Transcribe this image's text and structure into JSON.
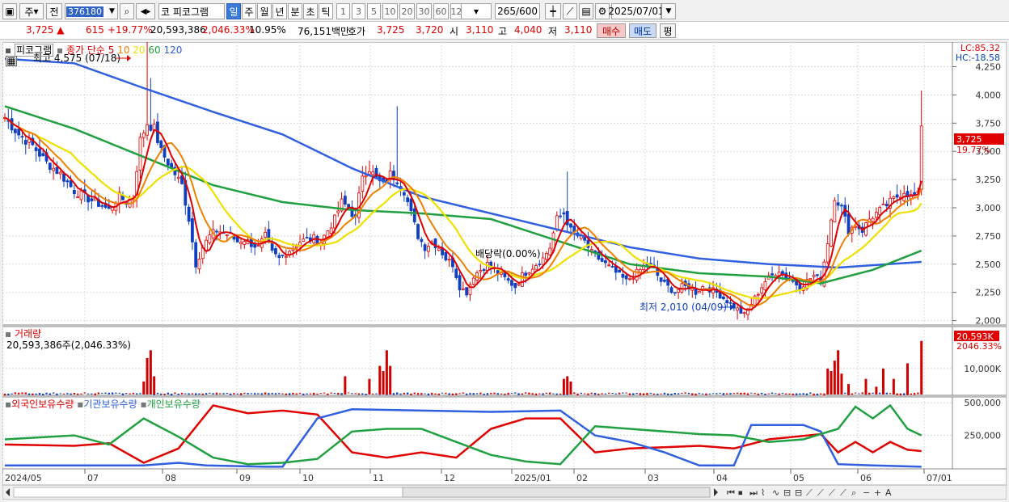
{
  "toolbar": {
    "market": "주",
    "prev_label": "전",
    "code": "376180",
    "stock_name_prefix": "코",
    "stock_name": "피코그램",
    "periods": [
      "일",
      "주",
      "월",
      "년",
      "분",
      "초",
      "틱"
    ],
    "active_period": "일",
    "intervals": [
      "1",
      "3",
      "5",
      "10",
      "20",
      "30",
      "60",
      "120"
    ],
    "count": "265",
    "count_total": "/600",
    "date": "2025/07/01"
  },
  "quote": {
    "price": "3,725",
    "direction": "▲",
    "change": "615",
    "change_pct": "+19.77%",
    "volume": "20,593,386",
    "volume_pct": "2,046.33%",
    "turnover_pct": "10.95%",
    "amount": "76,151백만",
    "ask_label": "호가",
    "ask": "3,725",
    "bid": "3,720",
    "open_label": "시",
    "open": "3,110",
    "high_label": "고",
    "high": "4,040",
    "low_label": "저",
    "low": "3,110",
    "buy_label": "매수",
    "sell_label": "매도",
    "eval_label": "평"
  },
  "price_panel": {
    "title": "피코그램",
    "ma_label": "종가 단순",
    "ma_periods": [
      "5",
      "10",
      "20",
      "60",
      "120"
    ],
    "ma_colors": [
      "#e00000",
      "#f08000",
      "#f0e000",
      "#20a040",
      "#3060e0"
    ],
    "high_annot": "최고 4,575 (07/18)",
    "low_annot": "최저 2,010 (04/09)",
    "dividend_annot": "배당락(0.00%)",
    "lc": "LC:85.32",
    "hc": "HC:-18.58",
    "last_price": "3,725",
    "last_pct": "19.77%"
  },
  "volume_panel": {
    "title": "거래량",
    "value_text": "20,593,386주(2,046.33%)",
    "last_label": "20,593K",
    "last_pct": "2046.33%"
  },
  "holdings_panel": {
    "series": [
      "외국인보유수량",
      "기관보유수량",
      "개인보유수량"
    ],
    "colors": [
      "#e00000",
      "#3060e0",
      "#20a040"
    ]
  },
  "chart_data": [
    {
      "type": "candlestick",
      "title": "피코그램",
      "x_ticks": [
        "2024/05",
        "07",
        "08",
        "09",
        "10",
        "11",
        "12",
        "2025/01",
        "02",
        "03",
        "04",
        "05",
        "06",
        "07/01"
      ],
      "y_ticks": [
        2000,
        2250,
        2500,
        2750,
        3000,
        3250,
        3500,
        3750,
        4000,
        4250
      ],
      "ylim": [
        1990,
        4440
      ],
      "close_series": [
        [
          0,
          3800
        ],
        [
          4,
          3650
        ],
        [
          8,
          3550
        ],
        [
          12,
          3400
        ],
        [
          16,
          3300
        ],
        [
          20,
          3150
        ],
        [
          24,
          3080
        ],
        [
          28,
          3020
        ],
        [
          30,
          2980
        ],
        [
          33,
          3100
        ],
        [
          35,
          3050
        ],
        [
          37,
          3100
        ],
        [
          39,
          3600
        ],
        [
          41,
          3750
        ],
        [
          43,
          3700
        ],
        [
          45,
          3500
        ],
        [
          47,
          3400
        ],
        [
          49,
          3300
        ],
        [
          51,
          3200
        ],
        [
          53,
          2900
        ],
        [
          55,
          2500
        ],
        [
          57,
          2650
        ],
        [
          59,
          2750
        ],
        [
          61,
          2800
        ],
        [
          63,
          2780
        ],
        [
          65,
          2750
        ],
        [
          67,
          2700
        ],
        [
          69,
          2720
        ],
        [
          71,
          2680
        ],
        [
          73,
          2650
        ],
        [
          75,
          2750
        ],
        [
          77,
          2600
        ],
        [
          79,
          2550
        ],
        [
          81,
          2600
        ],
        [
          83,
          2650
        ],
        [
          85,
          2700
        ],
        [
          87,
          2720
        ],
        [
          89,
          2730
        ],
        [
          91,
          2700
        ],
        [
          93,
          2800
        ],
        [
          95,
          2900
        ],
        [
          97,
          3050
        ],
        [
          99,
          3000
        ],
        [
          101,
          2900
        ],
        [
          103,
          3300
        ],
        [
          105,
          3350
        ],
        [
          107,
          3250
        ],
        [
          109,
          3200
        ],
        [
          111,
          3300
        ],
        [
          113,
          3250
        ],
        [
          115,
          3150
        ],
        [
          117,
          2950
        ],
        [
          119,
          2750
        ],
        [
          121,
          2650
        ],
        [
          123,
          2700
        ],
        [
          125,
          2650
        ],
        [
          127,
          2550
        ],
        [
          129,
          2500
        ],
        [
          131,
          2300
        ],
        [
          133,
          2250
        ],
        [
          135,
          2400
        ],
        [
          137,
          2450
        ],
        [
          139,
          2500
        ],
        [
          141,
          2450
        ],
        [
          143,
          2400
        ],
        [
          145,
          2350
        ],
        [
          147,
          2300
        ],
        [
          149,
          2400
        ],
        [
          151,
          2450
        ],
        [
          153,
          2500
        ],
        [
          155,
          2550
        ],
        [
          157,
          2650
        ],
        [
          159,
          2900
        ],
        [
          161,
          2950
        ],
        [
          163,
          2800
        ],
        [
          165,
          2750
        ],
        [
          167,
          2700
        ],
        [
          169,
          2600
        ],
        [
          171,
          2550
        ],
        [
          173,
          2500
        ],
        [
          175,
          2450
        ],
        [
          177,
          2400
        ],
        [
          179,
          2350
        ],
        [
          181,
          2400
        ],
        [
          183,
          2450
        ],
        [
          185,
          2500
        ],
        [
          187,
          2450
        ],
        [
          189,
          2350
        ],
        [
          191,
          2300
        ],
        [
          193,
          2250
        ],
        [
          195,
          2300
        ],
        [
          197,
          2300
        ],
        [
          199,
          2250
        ],
        [
          201,
          2300
        ],
        [
          203,
          2280
        ],
        [
          205,
          2250
        ],
        [
          207,
          2200
        ],
        [
          209,
          2150
        ],
        [
          211,
          2100
        ],
        [
          213,
          2050
        ],
        [
          215,
          2150
        ],
        [
          217,
          2250
        ],
        [
          219,
          2350
        ],
        [
          221,
          2400
        ],
        [
          223,
          2450
        ],
        [
          225,
          2380
        ],
        [
          227,
          2350
        ],
        [
          229,
          2300
        ],
        [
          231,
          2350
        ],
        [
          233,
          2400
        ],
        [
          235,
          2350
        ],
        [
          237,
          2700
        ],
        [
          239,
          3100
        ],
        [
          241,
          3000
        ],
        [
          243,
          2800
        ],
        [
          245,
          2850
        ],
        [
          247,
          2800
        ],
        [
          249,
          2900
        ],
        [
          251,
          2950
        ],
        [
          253,
          3000
        ],
        [
          255,
          3050
        ],
        [
          257,
          3100
        ],
        [
          259,
          3150
        ],
        [
          261,
          3100
        ],
        [
          263,
          3110
        ],
        [
          264,
          3725
        ]
      ],
      "ma120": [
        [
          0,
          4320
        ],
        [
          20,
          4280
        ],
        [
          40,
          4060
        ],
        [
          60,
          3850
        ],
        [
          80,
          3650
        ],
        [
          100,
          3350
        ],
        [
          120,
          3100
        ],
        [
          140,
          2950
        ],
        [
          160,
          2800
        ],
        [
          180,
          2650
        ],
        [
          200,
          2550
        ],
        [
          220,
          2500
        ],
        [
          240,
          2470
        ],
        [
          264,
          2520
        ]
      ],
      "ma60": [
        [
          0,
          3900
        ],
        [
          20,
          3700
        ],
        [
          40,
          3450
        ],
        [
          60,
          3200
        ],
        [
          80,
          3050
        ],
        [
          100,
          2980
        ],
        [
          120,
          2950
        ],
        [
          140,
          2900
        ],
        [
          160,
          2700
        ],
        [
          180,
          2500
        ],
        [
          200,
          2420
        ],
        [
          220,
          2390
        ],
        [
          235,
          2330
        ],
        [
          250,
          2450
        ],
        [
          264,
          2620
        ]
      ]
    },
    {
      "type": "bar",
      "title": "거래량",
      "y_ticks": [
        10000
      ],
      "y_unit": "K",
      "series": [
        {
          "name": "거래량",
          "values": [
            [
              40,
              5000
            ],
            [
              41,
              14000
            ],
            [
              42,
              17000
            ],
            [
              43,
              7000
            ],
            [
              98,
              7000
            ],
            [
              105,
              6000
            ],
            [
              108,
              11000
            ],
            [
              109,
              9000
            ],
            [
              110,
              17000
            ],
            [
              111,
              11000
            ],
            [
              161,
              6000
            ],
            [
              162,
              7000
            ],
            [
              163,
              5000
            ],
            [
              237,
              10000
            ],
            [
              238,
              9000
            ],
            [
              239,
              13000
            ],
            [
              240,
              17000
            ],
            [
              241,
              8000
            ],
            [
              243,
              4000
            ],
            [
              248,
              6000
            ],
            [
              251,
              3000
            ],
            [
              253,
              10000
            ],
            [
              256,
              6000
            ],
            [
              260,
              12000
            ],
            [
              264,
              20593
            ]
          ]
        }
      ]
    },
    {
      "type": "line",
      "y_ticks": [
        250000,
        500000
      ],
      "series": [
        {
          "name": "외국인보유수량",
          "values": [
            [
              0,
              180000
            ],
            [
              20,
              170000
            ],
            [
              30,
              190000
            ],
            [
              40,
              40000
            ],
            [
              50,
              150000
            ],
            [
              60,
              480000
            ],
            [
              70,
              420000
            ],
            [
              80,
              440000
            ],
            [
              90,
              410000
            ],
            [
              100,
              120000
            ],
            [
              110,
              80000
            ],
            [
              120,
              120000
            ],
            [
              130,
              80000
            ],
            [
              140,
              300000
            ],
            [
              150,
              380000
            ],
            [
              160,
              380000
            ],
            [
              170,
              120000
            ],
            [
              180,
              150000
            ],
            [
              190,
              160000
            ],
            [
              200,
              170000
            ],
            [
              210,
              150000
            ],
            [
              220,
              220000
            ],
            [
              235,
              260000
            ],
            [
              240,
              120000
            ],
            [
              245,
              200000
            ],
            [
              250,
              120000
            ],
            [
              255,
              200000
            ],
            [
              260,
              140000
            ],
            [
              264,
              130000
            ]
          ]
        },
        {
          "name": "기관보유수량",
          "values": [
            [
              0,
              20000
            ],
            [
              20,
              20000
            ],
            [
              40,
              20000
            ],
            [
              50,
              40000
            ],
            [
              58,
              20000
            ],
            [
              75,
              10000
            ],
            [
              80,
              10000
            ],
            [
              90,
              380000
            ],
            [
              100,
              450000
            ],
            [
              120,
              440000
            ],
            [
              140,
              430000
            ],
            [
              160,
              440000
            ],
            [
              170,
              250000
            ],
            [
              180,
              200000
            ],
            [
              190,
              120000
            ],
            [
              200,
              20000
            ],
            [
              210,
              20000
            ],
            [
              215,
              330000
            ],
            [
              230,
              330000
            ],
            [
              235,
              280000
            ],
            [
              240,
              30000
            ],
            [
              250,
              20000
            ],
            [
              264,
              10000
            ]
          ]
        },
        {
          "name": "개인보유수량",
          "values": [
            [
              0,
              220000
            ],
            [
              20,
              250000
            ],
            [
              30,
              180000
            ],
            [
              40,
              380000
            ],
            [
              50,
              240000
            ],
            [
              60,
              80000
            ],
            [
              70,
              30000
            ],
            [
              80,
              40000
            ],
            [
              90,
              70000
            ],
            [
              100,
              280000
            ],
            [
              110,
              300000
            ],
            [
              120,
              300000
            ],
            [
              130,
              200000
            ],
            [
              140,
              100000
            ],
            [
              150,
              50000
            ],
            [
              160,
              30000
            ],
            [
              170,
              320000
            ],
            [
              180,
              300000
            ],
            [
              190,
              280000
            ],
            [
              200,
              260000
            ],
            [
              210,
              250000
            ],
            [
              220,
              200000
            ],
            [
              230,
              220000
            ],
            [
              240,
              300000
            ],
            [
              245,
              470000
            ],
            [
              250,
              380000
            ],
            [
              255,
              480000
            ],
            [
              260,
              300000
            ],
            [
              264,
              250000
            ]
          ]
        }
      ]
    }
  ]
}
